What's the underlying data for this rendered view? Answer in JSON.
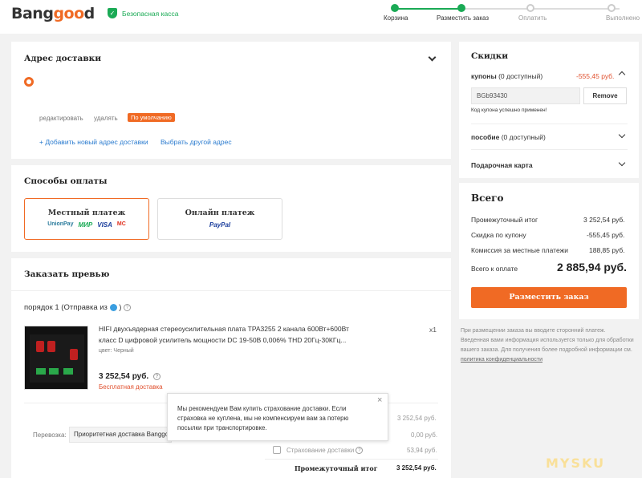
{
  "header": {
    "logo_part1": "Bang",
    "logo_part2": "goo",
    "logo_part3": "d",
    "secure_text": "Безопасная касса",
    "steps": [
      "Корзина",
      "Разместить заказ",
      "Оплатить",
      "Выполнено"
    ],
    "accent": "#f06a24",
    "success": "#1aaa55"
  },
  "address": {
    "title": "Адрес доставки",
    "edit": "редактировать",
    "delete": "удалять",
    "default_badge": "По умолчанию",
    "add_new": "+ Добавить новый адрес доставки",
    "choose_other": "Выбрать другой адрес"
  },
  "payment": {
    "title": "Способы оплаты",
    "local": "Местный платеж",
    "local_icons": [
      "UnionPay",
      "МИР",
      "VISA",
      "MC"
    ],
    "online": "Онлайн платеж",
    "online_icon": "PayPal"
  },
  "preview": {
    "title": "Заказать превью",
    "order_line": "порядок 1  (Отправка из",
    "order_line_end": ")",
    "product_name_1": "HIFI двухъядерная стереоусилительная плата TPA3255 2 канала 600Вт+600Вт",
    "product_name_2": "класс D цифровой усилитель мощности DC 19-50В 0,006% THD 20Гц-30КГц...",
    "color": "цвет: Черный",
    "qty": "x1",
    "price": "3 252,54 руб.",
    "free_shipping": "Бесплатная доставка",
    "shipping_label": "Перевозка:",
    "shipping_method": "Приоритетная доставка Banggood",
    "tooltip": "Мы рекомендуем Вам купить страхование доставки. Если страховка не куплена, мы не компенсируем вам за потерю посылки при транспортировке.",
    "row1_value": "3 252,54 руб.",
    "row2_value": "0,00 руб.",
    "insurance_label": "Страхование доставки",
    "insurance_value": "53,94 руб.",
    "subtotal_label": "Промежуточный итог",
    "subtotal_value": "3 252,54 руб."
  },
  "discounts": {
    "title": "Скидки",
    "coupons_label": "купоны",
    "coupons_available": " (0 доступный)",
    "coupons_value": "-555,45 руб.",
    "coupon_code": "BGb93430",
    "remove": "Remove",
    "coupon_applied": "Код купона успешно применен!",
    "allowance_label": "пособие",
    "allowance_available": " (0 доступный)",
    "gift_card": "Подарочная карта"
  },
  "total": {
    "title": "Всего",
    "subtotal_label": "Промежуточный итог",
    "subtotal_value": "3 252,54 руб.",
    "coupon_label": "Скидка по купону",
    "coupon_value": "-555,45 руб.",
    "fee_label": "Комиссия за местные платежи",
    "fee_value": "188,85 руб.",
    "pay_label": "Всего к оплате",
    "pay_value": "2 885,94 руб.",
    "place_order": "Разместить заказ",
    "note_1": "При размещении заказа вы вводите сторонний платеж.",
    "note_2": "Введенная вами информация используется только для обработки",
    "note_3": "вашего заказа. Для получения более подробной информации см.",
    "privacy": "политика конфиденциальности"
  },
  "watermark": "MYSKU"
}
